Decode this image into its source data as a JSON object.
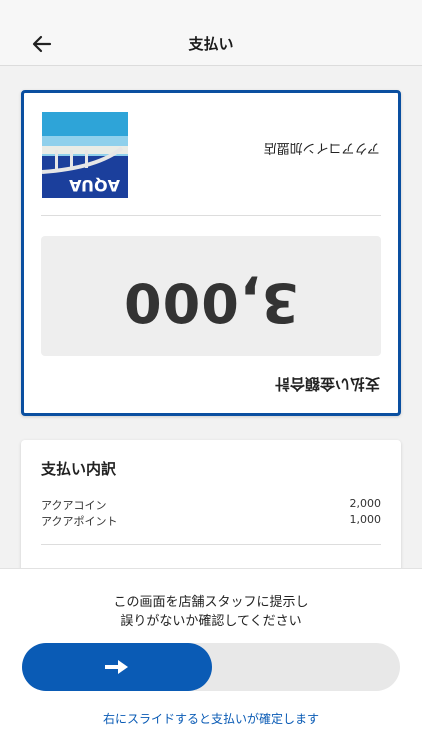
{
  "header": {
    "title": "支払い",
    "back_icon": "arrow-left-icon"
  },
  "payment": {
    "total_label": "支払い金額合計",
    "amount": "3,000",
    "store_name": "アクアコイン加盟店",
    "logo_text": "AQUA",
    "card_border_color": "#0a4fa0",
    "orientation": "rotated-180"
  },
  "breakdown": {
    "title": "支払い内訳",
    "items": [
      {
        "label": "アクアコイン",
        "value": "2,000"
      },
      {
        "label": "アクアポイント",
        "value": "1,000"
      }
    ]
  },
  "footer": {
    "instruction_line1": "この画面を店舗スタッフに提示し",
    "instruction_line2": "誤りがないか確認してください",
    "slider_icon": "arrow-right-icon",
    "slide_hint": "右にスライドすると支払いが確定します",
    "accent_color": "#0a5bb5"
  }
}
